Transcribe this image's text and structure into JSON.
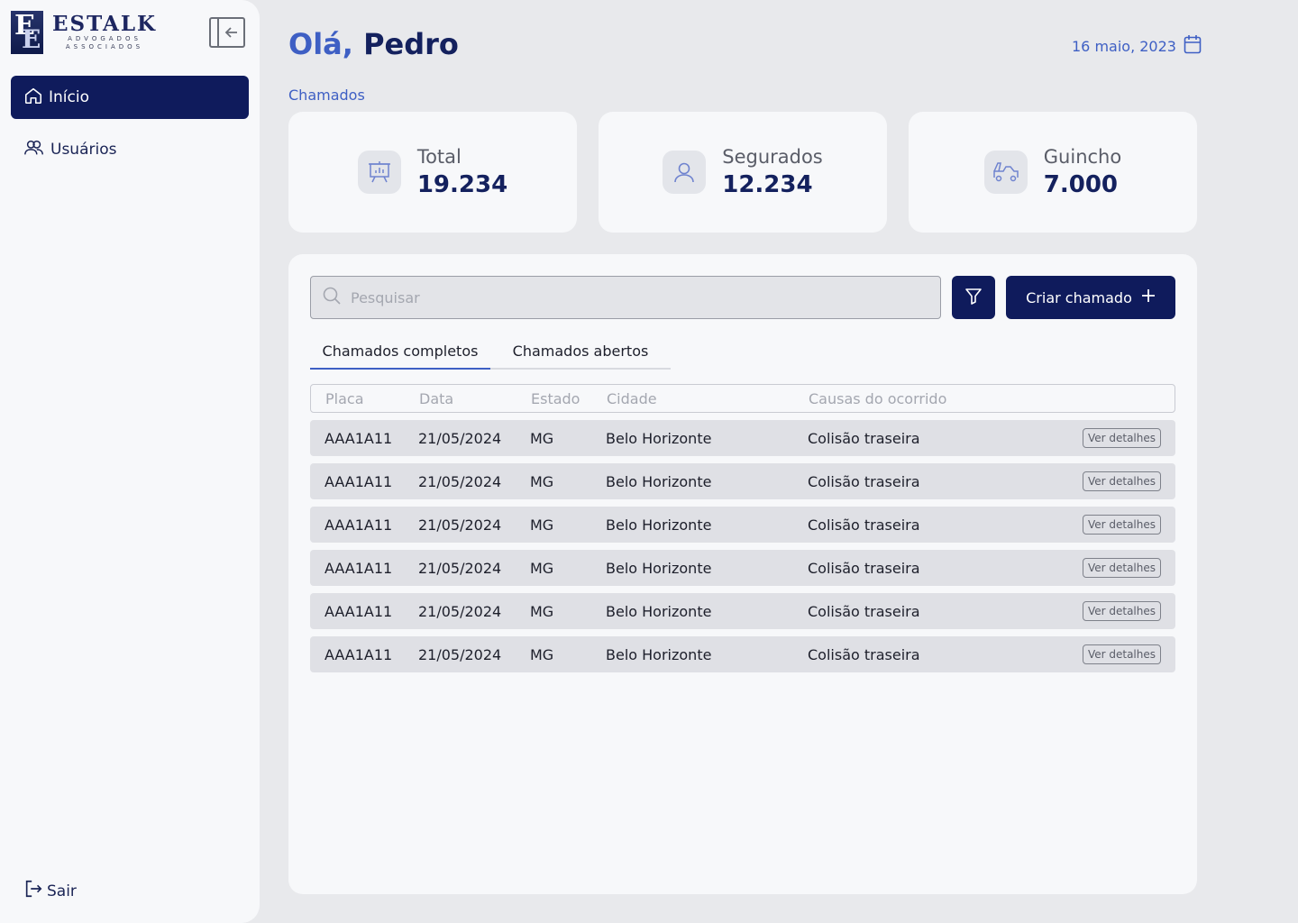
{
  "brand": {
    "letters_top": "E",
    "letters_bottom": "E",
    "name": "ESTALK",
    "subtitle_1": "ADVOGADOS",
    "subtitle_2": "ASSOCIADOS"
  },
  "sidebar": {
    "items": [
      {
        "label": "Início",
        "icon": "home-icon"
      },
      {
        "label": "Usuários",
        "icon": "users-icon"
      }
    ],
    "logout_label": "Sair"
  },
  "header": {
    "greeting": "Olá,",
    "user_name": "Pedro",
    "date": "16 maio, 2023"
  },
  "section_label": "Chamados",
  "stats": [
    {
      "label": "Total",
      "value": "19.234",
      "icon": "presentation-chart-icon"
    },
    {
      "label": "Segurados",
      "value": "12.234",
      "icon": "user-icon"
    },
    {
      "label": "Guincho",
      "value": "7.000",
      "icon": "tow-truck-icon"
    }
  ],
  "search": {
    "placeholder": "Pesquisar"
  },
  "create_button": "Criar chamado",
  "tabs": [
    "Chamados completos",
    "Chamados abertos"
  ],
  "table": {
    "columns": [
      "Placa",
      "Data",
      "Estado",
      "Cidade",
      "Causas do ocorrido"
    ],
    "rows": [
      [
        "AAA1A11",
        "21/05/2024",
        "MG",
        "Belo Horizonte",
        "Colisão traseira"
      ],
      [
        "AAA1A11",
        "21/05/2024",
        "MG",
        "Belo Horizonte",
        "Colisão traseira"
      ],
      [
        "AAA1A11",
        "21/05/2024",
        "MG",
        "Belo Horizonte",
        "Colisão traseira"
      ],
      [
        "AAA1A11",
        "21/05/2024",
        "MG",
        "Belo Horizonte",
        "Colisão traseira"
      ],
      [
        "AAA1A11",
        "21/05/2024",
        "MG",
        "Belo Horizonte",
        "Colisão traseira"
      ],
      [
        "AAA1A11",
        "21/05/2024",
        "MG",
        "Belo Horizonte",
        "Colisão traseira"
      ]
    ],
    "action_label": "Ver detalhes"
  },
  "colors": {
    "primary": "#0f1b5c",
    "accent": "#3e5fc4",
    "background": "#e8e9ec",
    "surface": "#f7f8fa",
    "row": "#dfe0e5"
  }
}
